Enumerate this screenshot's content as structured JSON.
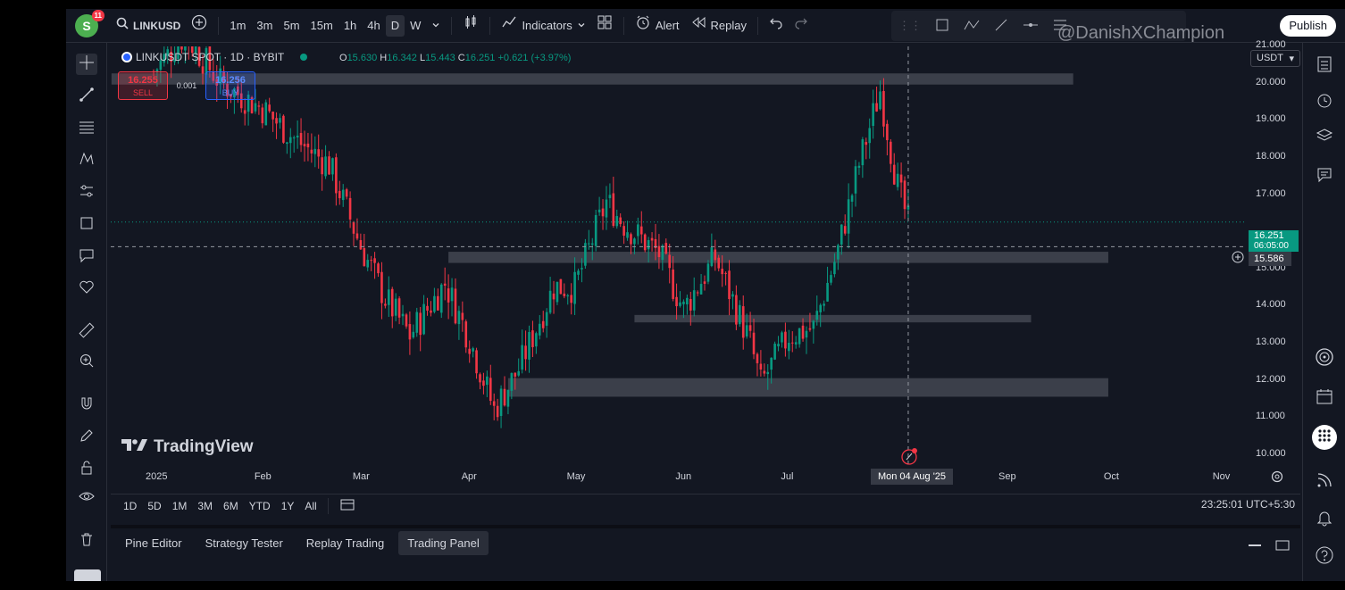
{
  "topbar": {
    "avatar_letter": "S",
    "avatar_badge": "11",
    "symbol": "LINKUSD",
    "intervals": [
      "1m",
      "3m",
      "5m",
      "15m",
      "1h",
      "4h",
      "D",
      "W"
    ],
    "selected_interval": "D",
    "indicators_label": "Indicators",
    "alert_label": "Alert",
    "replay_label": "Replay",
    "publish_label": "Publish"
  },
  "watermark": "@DanishXChampion",
  "legend": {
    "title": "LINKUSDT SPOT · 1D · BYBIT",
    "o_label": "O",
    "o": "15.630",
    "h_label": "H",
    "h": "16.342",
    "l_label": "L",
    "l": "15.443",
    "c_label": "C",
    "c": "16.251",
    "change": "+0.621 (+3.97%)"
  },
  "trade": {
    "sell_price": "16.255",
    "sell_label": "SELL",
    "spread": "0.001",
    "buy_price": "16.256",
    "buy_label": "BUY"
  },
  "logo": "TradingView",
  "currency": "USDT",
  "price_ticks": [
    "21.000",
    "20.000",
    "19.000",
    "18.000",
    "17.000",
    "15.000",
    "14.000",
    "13.000",
    "12.000",
    "11.000",
    "10.000"
  ],
  "last_price_label": "16.251",
  "countdown": "06:05:00",
  "crosshair_price": "15.586",
  "time_ticks": [
    "2025",
    "Feb",
    "Mar",
    "Apr",
    "May",
    "Jun",
    "Jul",
    "Sep",
    "Oct",
    "Nov"
  ],
  "crosshair_date": "Mon 04 Aug '25",
  "ranges": [
    "1D",
    "5D",
    "1M",
    "3M",
    "6M",
    "YTD",
    "1Y",
    "All"
  ],
  "clock": "23:25:01 UTC+5:30",
  "bottom_tabs": [
    "Pine Editor",
    "Strategy Tester",
    "Replay Trading",
    "Trading Panel"
  ],
  "selected_bottom_tab": "Trading Panel",
  "colors": {
    "up": "#089981",
    "down": "#f23645",
    "bg": "#131722",
    "zone": "#5d606b",
    "accent": "#2962ff"
  },
  "chart_data": {
    "type": "candlestick",
    "symbol": "LINKUSDT",
    "interval": "1D",
    "ylim": [
      10,
      21
    ],
    "support_resistance_zones": [
      {
        "low": 19.95,
        "high": 20.25,
        "from": "2024-12-20",
        "to": "2025-09-20"
      },
      {
        "low": 15.15,
        "high": 15.45,
        "from": "2025-03-26",
        "to": "2025-09-30"
      },
      {
        "low": 13.55,
        "high": 13.75,
        "from": "2025-05-18",
        "to": "2025-09-08"
      },
      {
        "low": 11.55,
        "high": 12.05,
        "from": "2025-04-12",
        "to": "2025-09-30"
      }
    ],
    "close_path": [
      [
        "2025-01-01",
        20.3
      ],
      [
        "2025-01-10",
        21.3
      ],
      [
        "2025-01-20",
        20.0
      ],
      [
        "2025-02-01",
        19.3
      ],
      [
        "2025-02-10",
        18.5
      ],
      [
        "2025-02-20",
        17.8
      ],
      [
        "2025-03-01",
        15.6
      ],
      [
        "2025-03-08",
        14.2
      ],
      [
        "2025-03-15",
        13.2
      ],
      [
        "2025-03-25",
        14.6
      ],
      [
        "2025-04-01",
        13.1
      ],
      [
        "2025-04-08",
        11.2
      ],
      [
        "2025-04-15",
        12.3
      ],
      [
        "2025-04-25",
        14.5
      ],
      [
        "2025-05-01",
        14.5
      ],
      [
        "2025-05-10",
        16.8
      ],
      [
        "2025-05-15",
        16.2
      ],
      [
        "2025-05-25",
        15.4
      ],
      [
        "2025-06-01",
        13.9
      ],
      [
        "2025-06-10",
        15.3
      ],
      [
        "2025-06-20",
        13.0
      ],
      [
        "2025-06-23",
        11.9
      ],
      [
        "2025-07-01",
        13.2
      ],
      [
        "2025-07-08",
        13.4
      ],
      [
        "2025-07-15",
        15.5
      ],
      [
        "2025-07-21",
        17.8
      ],
      [
        "2025-07-27",
        19.8
      ],
      [
        "2025-07-30",
        18.2
      ],
      [
        "2025-08-01",
        17.2
      ],
      [
        "2025-08-04",
        16.25
      ]
    ]
  }
}
